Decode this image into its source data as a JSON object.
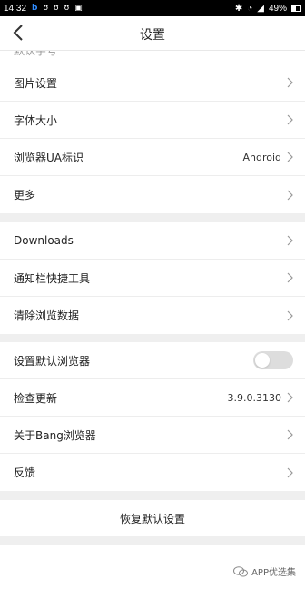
{
  "status_bar": {
    "time": "14:32",
    "left_icons": [
      "b-browser-icon",
      "u-icon",
      "u-icon",
      "u-icon",
      "image-icon"
    ],
    "battery_pct": "49%"
  },
  "header": {
    "title": "设置"
  },
  "partial_item_label": "默认字号",
  "group1": [
    {
      "label": "图片设置"
    },
    {
      "label": "字体大小"
    },
    {
      "label": "浏览器UA标识",
      "value": "Android"
    },
    {
      "label": "更多"
    }
  ],
  "group2": [
    {
      "label": "Downloads"
    },
    {
      "label": "通知栏快捷工具"
    },
    {
      "label": "清除浏览数据"
    }
  ],
  "group3": [
    {
      "label": "设置默认浏览器",
      "toggle_on": false
    },
    {
      "label": "检查更新",
      "value": "3.9.0.3130"
    },
    {
      "label": "关于Bang浏览器"
    },
    {
      "label": "反馈"
    }
  ],
  "reset_label": "恢复默认设置",
  "watermark": "APP优选集",
  "colors": {
    "accent": "#2f8cff",
    "toggle_off": "#dddddd",
    "divider": "#ededed"
  }
}
